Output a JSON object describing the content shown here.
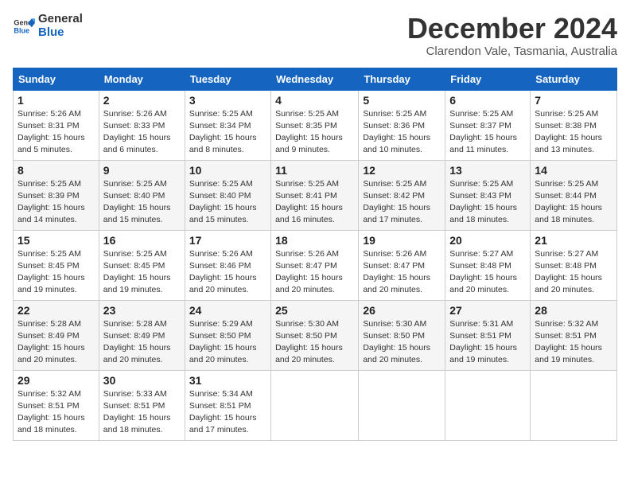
{
  "logo": {
    "line1": "General",
    "line2": "Blue"
  },
  "title": "December 2024",
  "location": "Clarendon Vale, Tasmania, Australia",
  "weekdays": [
    "Sunday",
    "Monday",
    "Tuesday",
    "Wednesday",
    "Thursday",
    "Friday",
    "Saturday"
  ],
  "weeks": [
    [
      {
        "day": "1",
        "sunrise": "5:26 AM",
        "sunset": "8:31 PM",
        "daylight": "15 hours and 5 minutes."
      },
      {
        "day": "2",
        "sunrise": "5:26 AM",
        "sunset": "8:33 PM",
        "daylight": "15 hours and 6 minutes."
      },
      {
        "day": "3",
        "sunrise": "5:25 AM",
        "sunset": "8:34 PM",
        "daylight": "15 hours and 8 minutes."
      },
      {
        "day": "4",
        "sunrise": "5:25 AM",
        "sunset": "8:35 PM",
        "daylight": "15 hours and 9 minutes."
      },
      {
        "day": "5",
        "sunrise": "5:25 AM",
        "sunset": "8:36 PM",
        "daylight": "15 hours and 10 minutes."
      },
      {
        "day": "6",
        "sunrise": "5:25 AM",
        "sunset": "8:37 PM",
        "daylight": "15 hours and 11 minutes."
      },
      {
        "day": "7",
        "sunrise": "5:25 AM",
        "sunset": "8:38 PM",
        "daylight": "15 hours and 13 minutes."
      }
    ],
    [
      {
        "day": "8",
        "sunrise": "5:25 AM",
        "sunset": "8:39 PM",
        "daylight": "15 hours and 14 minutes."
      },
      {
        "day": "9",
        "sunrise": "5:25 AM",
        "sunset": "8:40 PM",
        "daylight": "15 hours and 15 minutes."
      },
      {
        "day": "10",
        "sunrise": "5:25 AM",
        "sunset": "8:40 PM",
        "daylight": "15 hours and 15 minutes."
      },
      {
        "day": "11",
        "sunrise": "5:25 AM",
        "sunset": "8:41 PM",
        "daylight": "15 hours and 16 minutes."
      },
      {
        "day": "12",
        "sunrise": "5:25 AM",
        "sunset": "8:42 PM",
        "daylight": "15 hours and 17 minutes."
      },
      {
        "day": "13",
        "sunrise": "5:25 AM",
        "sunset": "8:43 PM",
        "daylight": "15 hours and 18 minutes."
      },
      {
        "day": "14",
        "sunrise": "5:25 AM",
        "sunset": "8:44 PM",
        "daylight": "15 hours and 18 minutes."
      }
    ],
    [
      {
        "day": "15",
        "sunrise": "5:25 AM",
        "sunset": "8:45 PM",
        "daylight": "15 hours and 19 minutes."
      },
      {
        "day": "16",
        "sunrise": "5:25 AM",
        "sunset": "8:45 PM",
        "daylight": "15 hours and 19 minutes."
      },
      {
        "day": "17",
        "sunrise": "5:26 AM",
        "sunset": "8:46 PM",
        "daylight": "15 hours and 20 minutes."
      },
      {
        "day": "18",
        "sunrise": "5:26 AM",
        "sunset": "8:47 PM",
        "daylight": "15 hours and 20 minutes."
      },
      {
        "day": "19",
        "sunrise": "5:26 AM",
        "sunset": "8:47 PM",
        "daylight": "15 hours and 20 minutes."
      },
      {
        "day": "20",
        "sunrise": "5:27 AM",
        "sunset": "8:48 PM",
        "daylight": "15 hours and 20 minutes."
      },
      {
        "day": "21",
        "sunrise": "5:27 AM",
        "sunset": "8:48 PM",
        "daylight": "15 hours and 20 minutes."
      }
    ],
    [
      {
        "day": "22",
        "sunrise": "5:28 AM",
        "sunset": "8:49 PM",
        "daylight": "15 hours and 20 minutes."
      },
      {
        "day": "23",
        "sunrise": "5:28 AM",
        "sunset": "8:49 PM",
        "daylight": "15 hours and 20 minutes."
      },
      {
        "day": "24",
        "sunrise": "5:29 AM",
        "sunset": "8:50 PM",
        "daylight": "15 hours and 20 minutes."
      },
      {
        "day": "25",
        "sunrise": "5:30 AM",
        "sunset": "8:50 PM",
        "daylight": "15 hours and 20 minutes."
      },
      {
        "day": "26",
        "sunrise": "5:30 AM",
        "sunset": "8:50 PM",
        "daylight": "15 hours and 20 minutes."
      },
      {
        "day": "27",
        "sunrise": "5:31 AM",
        "sunset": "8:51 PM",
        "daylight": "15 hours and 19 minutes."
      },
      {
        "day": "28",
        "sunrise": "5:32 AM",
        "sunset": "8:51 PM",
        "daylight": "15 hours and 19 minutes."
      }
    ],
    [
      {
        "day": "29",
        "sunrise": "5:32 AM",
        "sunset": "8:51 PM",
        "daylight": "15 hours and 18 minutes."
      },
      {
        "day": "30",
        "sunrise": "5:33 AM",
        "sunset": "8:51 PM",
        "daylight": "15 hours and 18 minutes."
      },
      {
        "day": "31",
        "sunrise": "5:34 AM",
        "sunset": "8:51 PM",
        "daylight": "15 hours and 17 minutes."
      },
      null,
      null,
      null,
      null
    ]
  ]
}
